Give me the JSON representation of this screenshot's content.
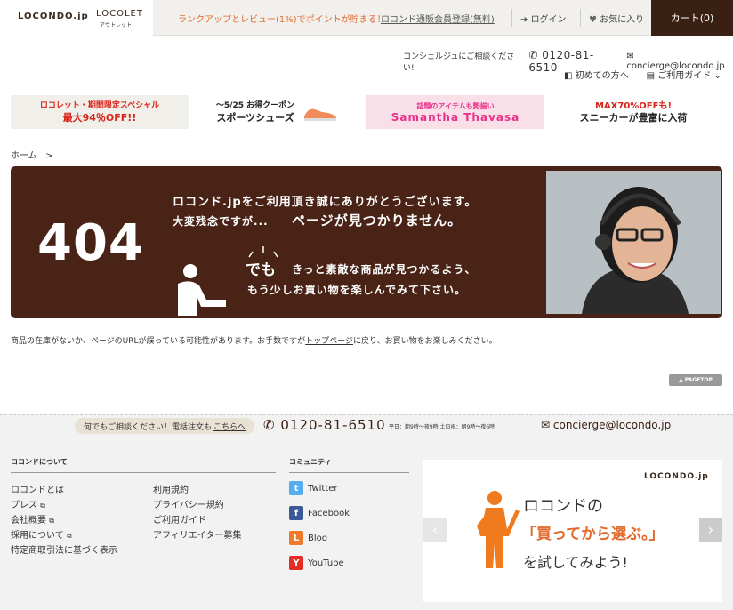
{
  "header": {
    "logo_main": "LOCONDO.jp",
    "logo_outlet": "LOCOLET",
    "logo_outlet_sub": "アウトレット",
    "promo": "ランクアップとレビュー(1%)でポイントが貯まる！",
    "register": "ロコンド通販会員登録(無料)",
    "login": "ログイン",
    "favorites": "お気に入り",
    "cart": "カート(0)"
  },
  "contact": {
    "label": "コンシェルジュにご相談ください!",
    "tel": "0120-81-6510",
    "mail": "concierge@locondo.jp"
  },
  "guides": {
    "first": "初めての方へ",
    "guide": "ご利用ガイド"
  },
  "banners": [
    {
      "line1": "ロコレット・期間限定スペシャル",
      "line2": "最大94％OFF!!"
    },
    {
      "line1": "〜5/25 お得クーポン",
      "line2": "スポーツシューズ"
    },
    {
      "line1": "話題のアイテムも勢揃い",
      "line2": "Samantha Thavasa"
    },
    {
      "line1": "MAX70%OFFも!",
      "line2": "スニーカーが豊富に入荷"
    }
  ],
  "breadcrumb": {
    "home": "ホーム",
    "sep": ">"
  },
  "error_panel": {
    "code": "404",
    "line1": "ロコンド.jpをご利用頂き誠にありがとうございます。",
    "line2a": "大変残念ですが...",
    "line2b": "ページが見つかりません。",
    "demo": "でも",
    "line3": "きっと素敵な商品が見つかるよう、",
    "line4": "もう少しお買い物を楽しんでみて下さい。"
  },
  "message": {
    "before": "商品の在庫がないか、ページのURLが誤っている可能性があります。お手数ですが",
    "link": "トップページ",
    "after": "に戻り、お買い物をお楽しみください。"
  },
  "pagetop": "▲ PAGETOP",
  "footer": {
    "call_text": "何でもご相談ください！電話注文も",
    "call_link": "こちらへ",
    "tel": "0120-81-6510",
    "hours": "平日：朝9時〜夜9時 土日祝：朝9時〜夜6時",
    "mail": "concierge@locondo.jp",
    "about_head": "ロコンドについて",
    "about_col1": [
      "ロコンドとは",
      "プレス",
      "会社概要",
      "採用について",
      "特定商取引法に基づく表示"
    ],
    "about_col2": [
      "利用規約",
      "プライバシー規約",
      "ご利用ガイド",
      "アフィリエイター募集"
    ],
    "community_head": "コミュニティ",
    "community": [
      {
        "label": "Twitter",
        "icon": "twitter-icon",
        "color": "#55acee",
        "glyph": "t"
      },
      {
        "label": "Facebook",
        "icon": "facebook-icon",
        "color": "#3b5998",
        "glyph": "f"
      },
      {
        "label": "Blog",
        "icon": "blog-icon",
        "color": "#f07a2a",
        "glyph": "L"
      },
      {
        "label": "YouTube",
        "icon": "youtube-icon",
        "color": "#e52d27",
        "glyph": "Y"
      }
    ]
  },
  "ad": {
    "logo": "LOCONDO.jp",
    "line1": "ロコンドの",
    "line2": "「買ってから選ぶ。」",
    "line3": "を試してみよう!"
  },
  "colors": {
    "brand_brown": "#4a2317",
    "cart_bg": "#3a1f13",
    "accent_orange": "#e26a2c"
  }
}
